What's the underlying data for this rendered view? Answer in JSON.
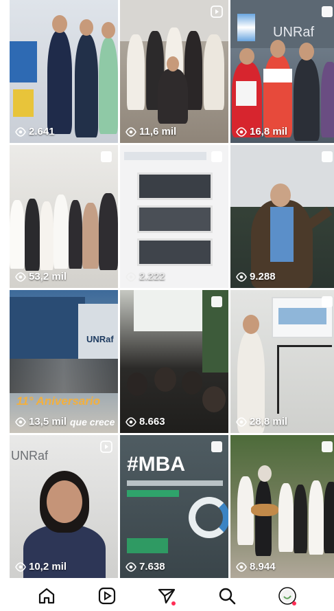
{
  "posts": [
    {
      "views": "2.641",
      "type": "photo"
    },
    {
      "views": "11,6 mil",
      "type": "reel"
    },
    {
      "views": "16,8 mil",
      "type": "carousel",
      "sign": "UNRaf"
    },
    {
      "views": "53,2 mil",
      "type": "carousel"
    },
    {
      "views": "2.222",
      "type": "carousel"
    },
    {
      "views": "9.288",
      "type": "carousel"
    },
    {
      "views": "13,5 mil",
      "type": "photo",
      "caption_line1": "11° Aniversario",
      "caption_line2": "que crece",
      "building_sign": "UNRaf"
    },
    {
      "views": "8.663",
      "type": "carousel"
    },
    {
      "views": "28,8 mil",
      "type": "carousel"
    },
    {
      "views": "10,2 mil",
      "type": "reel",
      "sign": "UNRaf"
    },
    {
      "views": "7.638",
      "type": "carousel",
      "title": "#MBA"
    },
    {
      "views": "8.944",
      "type": "carousel"
    }
  ],
  "nav": {
    "icons": [
      "home-icon",
      "reels-icon",
      "share-icon",
      "search-icon",
      "profile-icon"
    ],
    "accent": "#ff2d55"
  }
}
